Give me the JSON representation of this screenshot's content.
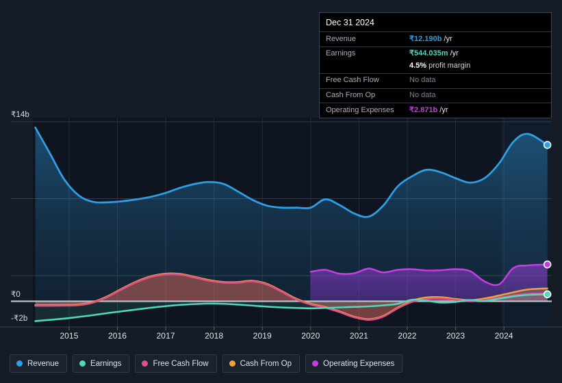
{
  "tooltip": {
    "date": "Dec 31 2024",
    "rows": [
      {
        "key": "Revenue",
        "amount": "₹12.190b",
        "unit": " /yr",
        "color": "#2f9fe3",
        "nodata": false
      },
      {
        "key": "Earnings",
        "amount": "₹544.035m",
        "unit": " /yr",
        "color": "#4fd9c0",
        "nodata": false
      },
      {
        "key": "",
        "amount": "4.5%",
        "unit": " profit margin",
        "color": "#ffffff",
        "nodata": false,
        "sub": true
      },
      {
        "key": "Free Cash Flow",
        "amount": "No data",
        "unit": "",
        "color": "#7b818d",
        "nodata": true
      },
      {
        "key": "Cash From Op",
        "amount": "No data",
        "unit": "",
        "color": "#7b818d",
        "nodata": true
      },
      {
        "key": "Operating Expenses",
        "amount": "₹2.871b",
        "unit": " /yr",
        "color": "#c13fe0",
        "nodata": false
      }
    ]
  },
  "legend": {
    "items": [
      {
        "label": "Revenue",
        "color": "#2f9fe3"
      },
      {
        "label": "Earnings",
        "color": "#4fd9c0"
      },
      {
        "label": "Free Cash Flow",
        "color": "#e0508a"
      },
      {
        "label": "Cash From Op",
        "color": "#eba43c"
      },
      {
        "label": "Operating Expenses",
        "color": "#c13fe0"
      }
    ]
  },
  "axis": {
    "y_top": "₹14b",
    "y_zero": "₹0",
    "y_bottom": "-₹2b",
    "x_ticks": [
      "2015",
      "2016",
      "2017",
      "2018",
      "2019",
      "2020",
      "2021",
      "2022",
      "2023",
      "2024"
    ]
  },
  "chart_data": {
    "type": "area",
    "title": "",
    "xlabel": "",
    "ylabel": "",
    "ylim": [
      -2,
      14
    ],
    "xlim": [
      2014.25,
      2024.99
    ],
    "ytick_values": [
      14,
      0,
      -2
    ],
    "ytick_labels": [
      "₹14b",
      "₹0",
      "-₹2b"
    ],
    "gridlines_y": [
      14,
      8,
      2,
      0,
      -2
    ],
    "grid": true,
    "legend_position": "bottom-left",
    "currency": "INR",
    "units": "billions",
    "forecast_start_x": 2023.95,
    "x": [
      2014.3,
      2014.6,
      2014.9,
      2015.2,
      2015.5,
      2015.8,
      2016.1,
      2016.4,
      2016.7,
      2017.0,
      2017.3,
      2017.6,
      2017.9,
      2018.2,
      2018.5,
      2018.8,
      2019.1,
      2019.4,
      2019.7,
      2020.0,
      2020.3,
      2020.6,
      2020.9,
      2021.2,
      2021.5,
      2021.8,
      2022.1,
      2022.4,
      2022.7,
      2023.0,
      2023.3,
      2023.6,
      2023.9,
      2024.2,
      2024.5,
      2024.9
    ],
    "series": [
      {
        "name": "Revenue",
        "color": "#2f9fe3",
        "end_value": 12.19,
        "values": [
          13.55,
          11.55,
          9.5,
          8.25,
          7.75,
          7.72,
          7.8,
          7.95,
          8.15,
          8.45,
          8.85,
          9.15,
          9.3,
          9.15,
          8.55,
          7.9,
          7.45,
          7.3,
          7.3,
          7.3,
          7.95,
          7.5,
          6.85,
          6.6,
          7.45,
          8.95,
          9.75,
          10.25,
          10.05,
          9.6,
          9.25,
          9.6,
          10.75,
          12.45,
          13.05,
          12.19
        ]
      },
      {
        "name": "Earnings",
        "color": "#4fd9c0",
        "end_value": 0.544,
        "values": [
          -1.55,
          -1.45,
          -1.35,
          -1.22,
          -1.08,
          -0.92,
          -0.78,
          -0.64,
          -0.5,
          -0.38,
          -0.28,
          -0.22,
          -0.18,
          -0.2,
          -0.26,
          -0.34,
          -0.42,
          -0.48,
          -0.52,
          -0.55,
          -0.52,
          -0.48,
          -0.44,
          -0.4,
          -0.32,
          -0.2,
          0.12,
          0.04,
          -0.1,
          -0.05,
          0.1,
          0.02,
          0.2,
          0.38,
          0.5,
          0.544
        ]
      },
      {
        "name": "Free Cash Flow",
        "color": "#e0508a",
        "end_value": null,
        "values": [
          -0.35,
          -0.35,
          -0.34,
          -0.3,
          -0.1,
          0.35,
          0.95,
          1.5,
          1.9,
          2.1,
          2.08,
          1.85,
          1.6,
          1.45,
          1.45,
          1.55,
          1.3,
          0.75,
          0.15,
          -0.25,
          -0.5,
          -0.85,
          -1.25,
          -1.45,
          -1.2,
          -0.55,
          -0.05,
          0.18,
          0.22,
          0.1,
          0.0,
          0.1,
          0.28,
          0.45,
          0.58,
          0.62
        ]
      },
      {
        "name": "Cash From Op",
        "color": "#eba43c",
        "end_value": null,
        "values": [
          -0.3,
          -0.3,
          -0.29,
          -0.25,
          -0.05,
          0.4,
          1.0,
          1.55,
          1.95,
          2.15,
          2.13,
          1.9,
          1.65,
          1.5,
          1.5,
          1.6,
          1.35,
          0.8,
          0.2,
          -0.2,
          -0.45,
          -0.8,
          -1.2,
          -1.4,
          -1.15,
          -0.5,
          0.05,
          0.3,
          0.32,
          0.18,
          0.08,
          0.22,
          0.45,
          0.7,
          0.92,
          1.0
        ]
      },
      {
        "name": "Operating Expenses",
        "color": "#c13fe0",
        "end_value": 2.871,
        "start_x": 2019.98,
        "values": [
          null,
          null,
          null,
          null,
          null,
          null,
          null,
          null,
          null,
          null,
          null,
          null,
          null,
          null,
          null,
          null,
          null,
          null,
          null,
          2.3,
          2.45,
          2.15,
          2.18,
          2.55,
          2.25,
          2.45,
          2.5,
          2.4,
          2.42,
          2.5,
          2.35,
          1.55,
          1.32,
          2.6,
          2.8,
          2.871
        ]
      }
    ]
  }
}
